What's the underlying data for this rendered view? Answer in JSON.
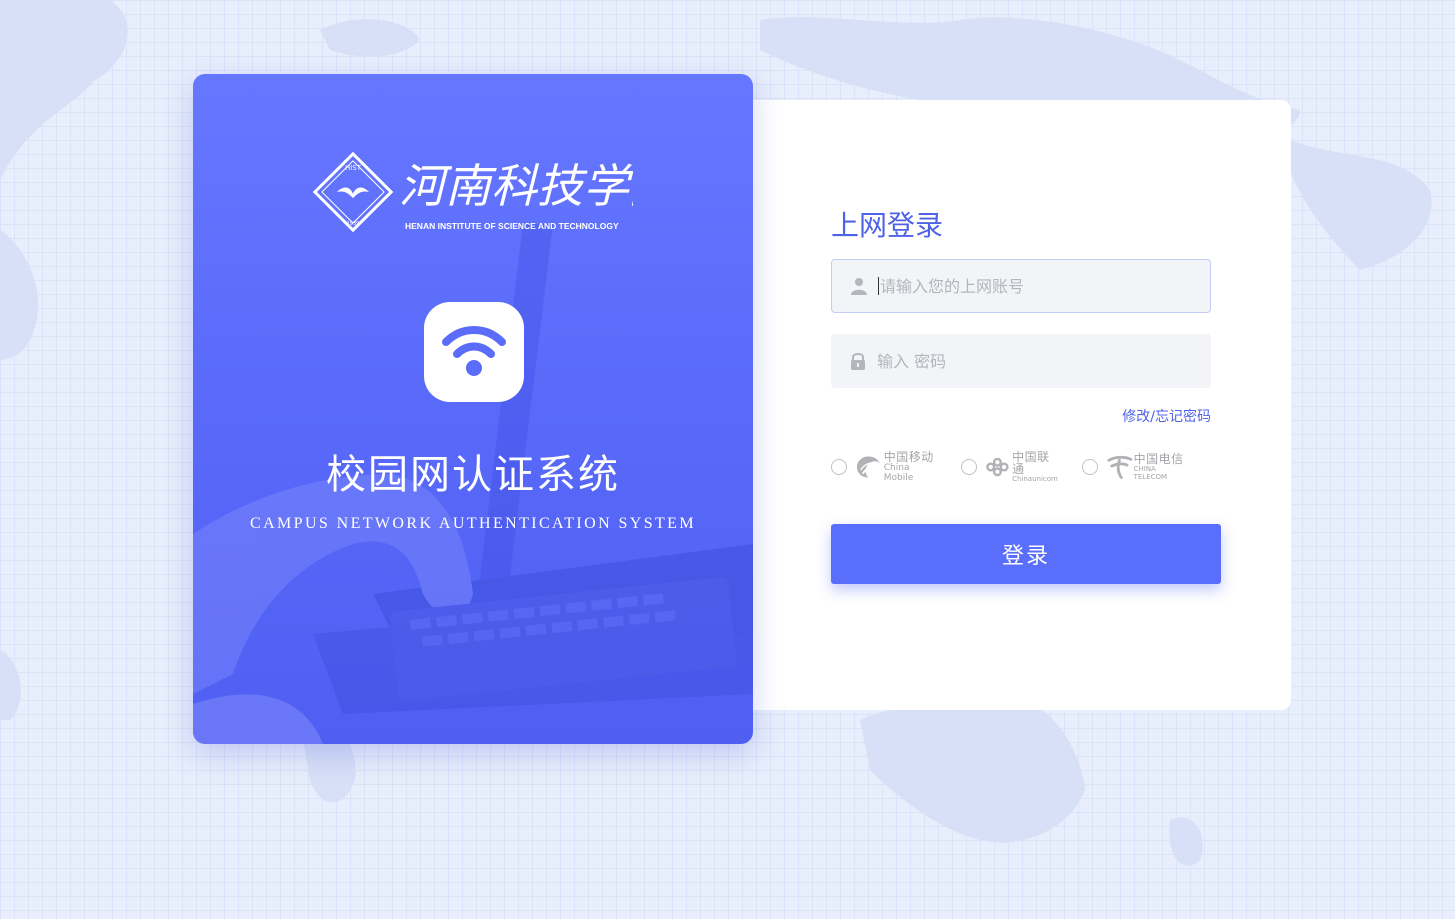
{
  "left_panel": {
    "logo": {
      "chinese_name": "河南科技学院",
      "english_name": "HENAN INSTITUTE OF SCIENCE AND TECHNOLOGY",
      "seal_top": "HIST",
      "seal_year": "1939"
    },
    "system_title": "校园网认证系统",
    "system_subtitle": "CAMPUS NETWORK AUTHENTICATION SYSTEM",
    "icon": "wifi-icon"
  },
  "login_form": {
    "title": "上网登录",
    "account": {
      "placeholder": "请输入您的上网账号",
      "value": "",
      "icon": "user-icon"
    },
    "password": {
      "placeholder": "输入 密码",
      "value": "",
      "icon": "lock-icon"
    },
    "forgot_link": "修改/忘记密码",
    "carriers": [
      {
        "cn": "中国移动",
        "en": "China Mobile",
        "icon": "china-mobile-logo",
        "selected": false
      },
      {
        "cn": "中国联通",
        "en": "Chinaunicom",
        "icon": "china-unicom-logo",
        "selected": false
      },
      {
        "cn": "中国电信",
        "en": "CHINA TELECOM",
        "icon": "china-telecom-logo",
        "selected": false
      }
    ],
    "submit_label": "登录"
  },
  "colors": {
    "accent": "#5a6efc",
    "title": "#4f63e8",
    "background": "#e8eefb",
    "panel": "#6677ff"
  }
}
